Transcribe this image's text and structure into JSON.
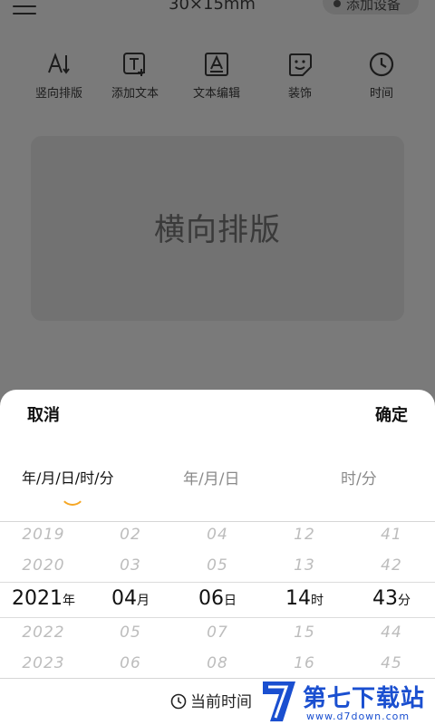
{
  "header": {
    "label_size": "30×15mm",
    "chevron": "˅",
    "add_device": "添加设备"
  },
  "toolbar": [
    {
      "label": "竖向排版",
      "icon": "vertical-text-icon"
    },
    {
      "label": "添加文本",
      "icon": "add-text-icon"
    },
    {
      "label": "文本编辑",
      "icon": "text-edit-icon"
    },
    {
      "label": "装饰",
      "icon": "sticker-icon"
    },
    {
      "label": "时间",
      "icon": "clock-icon"
    }
  ],
  "canvas": {
    "text": "横向排版"
  },
  "sheet": {
    "cancel": "取消",
    "confirm": "确定",
    "tabs": [
      "年/月/日/时/分",
      "年/月/日",
      "时/分"
    ],
    "active_tab": 0,
    "accent_color": "#f5a623",
    "columns": [
      {
        "values": [
          "2019",
          "2020",
          "2021",
          "2022",
          "2023"
        ],
        "selected": "2021",
        "unit": "年"
      },
      {
        "values": [
          "02",
          "03",
          "04",
          "05",
          "06"
        ],
        "selected": "04",
        "unit": "月"
      },
      {
        "values": [
          "04",
          "05",
          "06",
          "07",
          "08"
        ],
        "selected": "06",
        "unit": "日"
      },
      {
        "values": [
          "12",
          "13",
          "14",
          "15",
          "16"
        ],
        "selected": "14",
        "unit": "时"
      },
      {
        "values": [
          "41",
          "42",
          "43",
          "44",
          "45"
        ],
        "selected": "43",
        "unit": "分"
      }
    ],
    "current_time": "当前时间"
  },
  "watermark": {
    "name": "第七下载站",
    "url": "www.d7down.com"
  }
}
